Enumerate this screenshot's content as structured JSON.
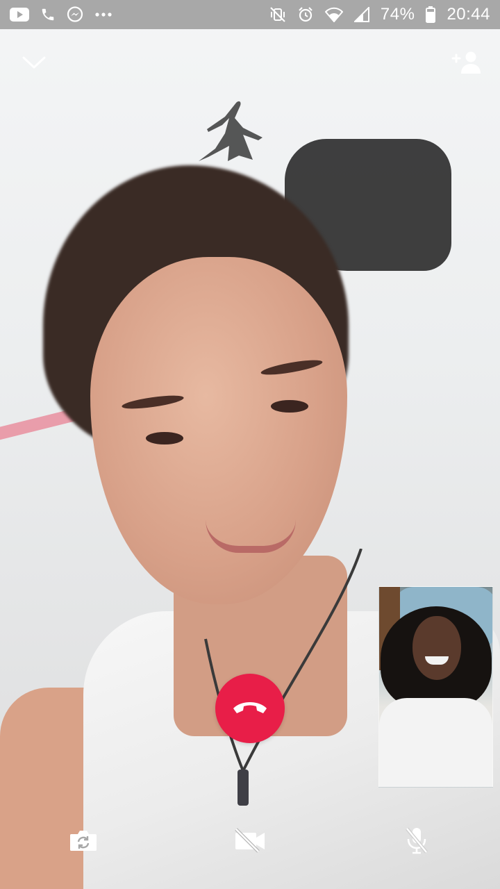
{
  "status_bar": {
    "battery_percent": "74%",
    "clock": "20:44",
    "left_icons": [
      "youtube-icon",
      "phone-icon",
      "messenger-icon",
      "more-dots-icon"
    ],
    "right_icons": [
      "vibrate-mute-icon",
      "alarm-icon",
      "wifi-icon",
      "signal-icon",
      "battery-icon"
    ]
  },
  "call": {
    "top_controls": [
      "chevron-down-icon",
      "add-person-icon"
    ],
    "bottom_controls": [
      "flip-camera-icon",
      "video-off-icon",
      "mic-off-icon"
    ],
    "end_call_icon": "hang-up-icon"
  },
  "colors": {
    "end_call": "#e81e48",
    "status_bar": "#a8a8a8",
    "icon": "#ffffff"
  }
}
